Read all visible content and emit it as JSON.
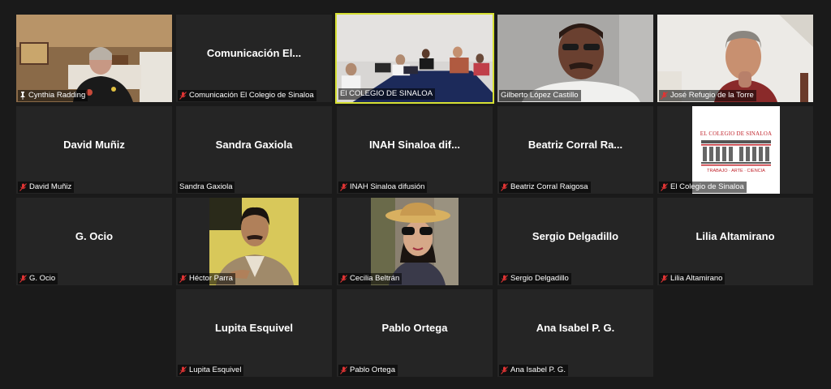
{
  "colors": {
    "background": "#1a1a1a",
    "tile": "#252525",
    "active_border": "#d6e033",
    "muted_mic": "#e03434"
  },
  "participants": [
    {
      "id": "cynthia",
      "display": "",
      "label": "Cynthia Radding",
      "mic": "pin-icon"
    },
    {
      "id": "comunicacion",
      "display": "Comunicación  El...",
      "label": "Comunicación El Colegio de Sinaloa",
      "mic": "muted"
    },
    {
      "id": "colegio-video",
      "display": "",
      "label": "El COLEGIO DE SINALOA",
      "mic": "none"
    },
    {
      "id": "gilberto",
      "display": "",
      "label": "Gilberto López Castillo",
      "mic": "none"
    },
    {
      "id": "jose",
      "display": "",
      "label": "José Refugio de la Torre",
      "mic": "muted"
    },
    {
      "id": "david",
      "display": "David Muñiz",
      "label": "David Muñiz",
      "mic": "muted"
    },
    {
      "id": "sandra",
      "display": "Sandra Gaxiola",
      "label": "Sandra Gaxiola",
      "mic": "none"
    },
    {
      "id": "inah",
      "display": "INAH Sinaloa dif...",
      "label": "INAH Sinaloa difusión",
      "mic": "muted"
    },
    {
      "id": "beatriz",
      "display": "Beatriz Corral Ra...",
      "label": "Beatriz Corral Raigosa",
      "mic": "muted"
    },
    {
      "id": "colegio-logo",
      "display": "",
      "label": "El Colegio de Sinaloa",
      "mic": "muted"
    },
    {
      "id": "gocio",
      "display": "G. Ocio",
      "label": "G. Ocio",
      "mic": "muted"
    },
    {
      "id": "hector",
      "display": "",
      "label": "Héctor Parra",
      "mic": "muted"
    },
    {
      "id": "cecilia",
      "display": "",
      "label": "Cecilia Beltrán",
      "mic": "muted"
    },
    {
      "id": "sergio",
      "display": "Sergio Delgadillo",
      "label": "Sergio Delgadillo",
      "mic": "muted"
    },
    {
      "id": "lilia",
      "display": "Lilia Altamirano",
      "label": "Lilia Altamirano",
      "mic": "muted"
    },
    {
      "id": "lupita",
      "display": "Lupita Esquivel",
      "label": "Lupita Esquivel",
      "mic": "muted"
    },
    {
      "id": "pablo",
      "display": "Pablo Ortega",
      "label": "Pablo Ortega",
      "mic": "muted"
    },
    {
      "id": "ana",
      "display": "Ana Isabel P. G.",
      "label": "Ana Isabel P. G.",
      "mic": "muted"
    }
  ],
  "logo": {
    "title": "EL COLEGIO DE SINALOA",
    "motto": "TRABAJO · ARTE · CIENCIA"
  }
}
